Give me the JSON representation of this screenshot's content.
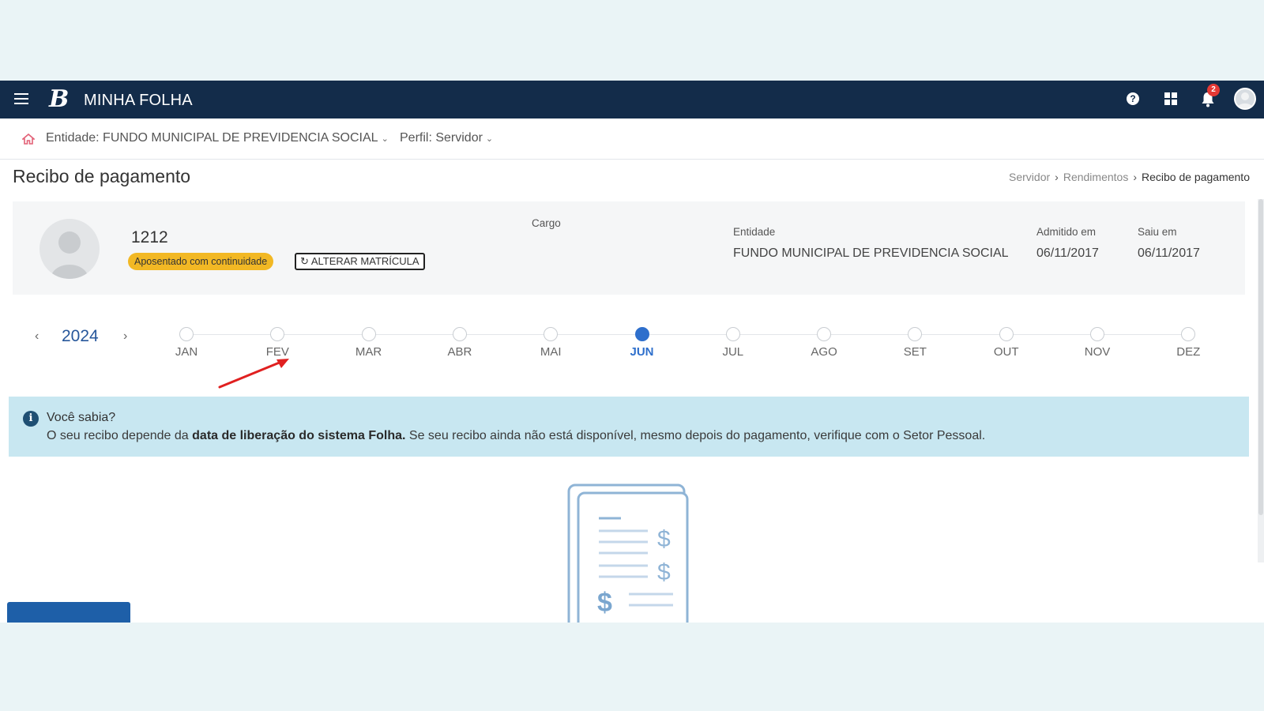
{
  "app": {
    "title": "MINHA FOLHA",
    "brand_letter": "B",
    "notification_count": "2"
  },
  "entity_bar": {
    "entity_label": "Entidade: FUNDO MUNICIPAL DE PREVIDENCIA SOCIAL",
    "profile_label": "Perfil: Servidor"
  },
  "page": {
    "title": "Recibo de pagamento",
    "breadcrumb": [
      "Servidor",
      "Rendimentos",
      "Recibo de pagamento"
    ]
  },
  "employee": {
    "registration": "1212",
    "status": "Aposentado com continuidade",
    "alter_button": "ALTERAR MATRÍCULA",
    "cargo_label": "Cargo",
    "entity_label": "Entidade",
    "entity_value": "FUNDO MUNICIPAL DE PREVIDENCIA SOCIAL",
    "admitted_label": "Admitido em",
    "admitted_value": "06/11/2017",
    "left_label": "Saiu em",
    "left_value": "06/11/2017"
  },
  "calendar": {
    "year": "2024",
    "months": [
      "JAN",
      "FEV",
      "MAR",
      "ABR",
      "MAI",
      "JUN",
      "JUL",
      "AGO",
      "SET",
      "OUT",
      "NOV",
      "DEZ"
    ],
    "selected_month": "JUN"
  },
  "info": {
    "title": "Você sabia?",
    "text_before": "O seu recibo depende da ",
    "text_bold": "data de liberação do sistema Folha.",
    "text_after": " Se seu recibo ainda não está disponível, mesmo depois do pagamento, verifique com o Setor Pessoal."
  },
  "colors": {
    "topbar": "#132c4a",
    "accent": "#2e6fcc",
    "badge": "#f2b824",
    "info_bg": "#c8e7f1",
    "annotation_arrow": "#e02020"
  },
  "icons": [
    "menu-icon",
    "help-icon",
    "apps-grid-icon",
    "bell-icon",
    "user-avatar",
    "home-icon",
    "refresh-icon",
    "info-icon",
    "receipt-illustration"
  ]
}
